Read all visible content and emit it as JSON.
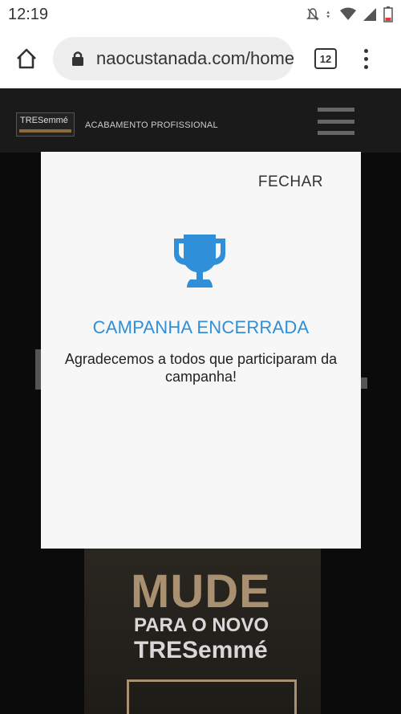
{
  "status_bar": {
    "time": "12:19",
    "icons": [
      "notifications-off-icon",
      "data-arrows-icon",
      "wifi-icon",
      "signal-icon",
      "battery-low-icon"
    ]
  },
  "browser": {
    "url": "naocustanada.com/home",
    "tab_count": "12",
    "icons": [
      "home-icon",
      "lock-icon",
      "overflow-menu-icon"
    ]
  },
  "site_header": {
    "brand": "TRESemmé",
    "tagline": "ACABAMENTO PROFISSIONAL",
    "menu_icon": "hamburger-icon"
  },
  "modal": {
    "close_label": "FECHAR",
    "icon": "trophy-icon",
    "title": "CAMPANHA ENCERRADA",
    "message": "Agradecemos a todos que participaram da campanha!",
    "accent_color": "#2f8fd8"
  },
  "product": {
    "headline": "MUDE",
    "line2": "PARA O NOVO",
    "line3": "TRESemmé"
  }
}
